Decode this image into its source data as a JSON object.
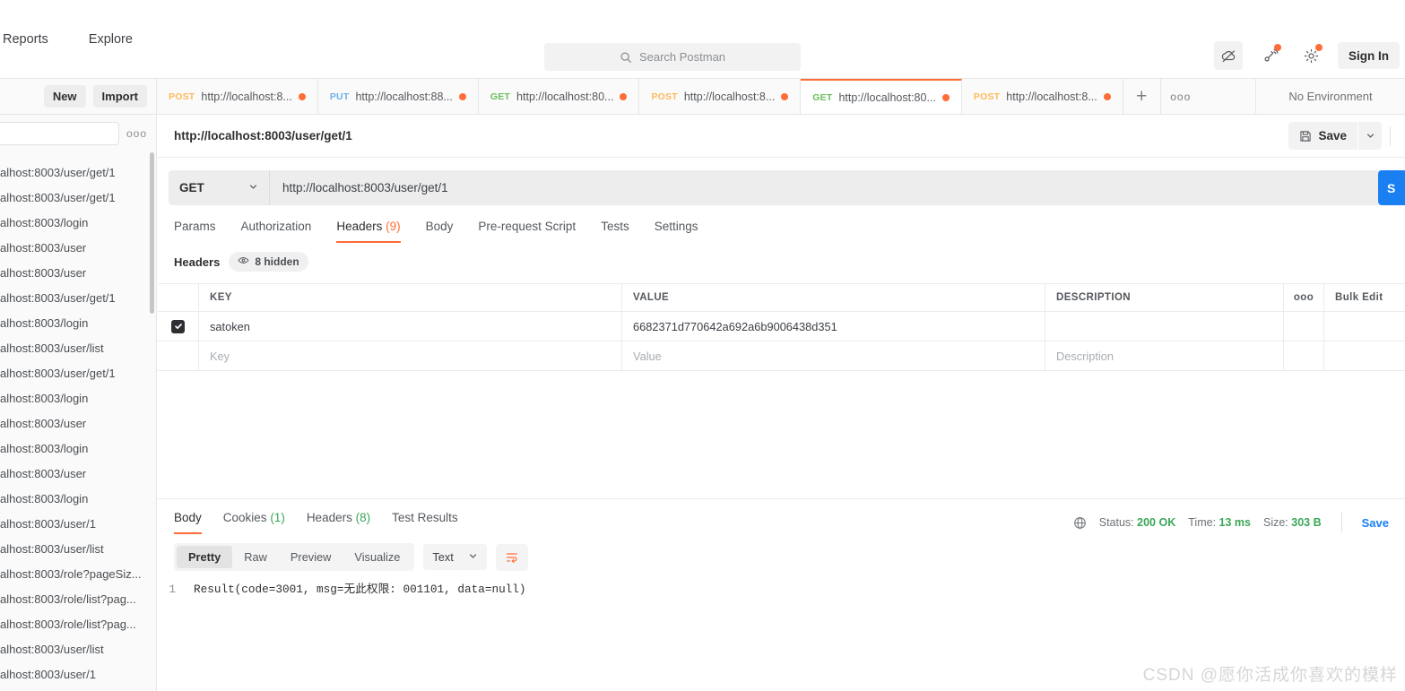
{
  "topnav": {
    "items": [
      {
        "label": "Reports",
        "name": "topnav-reports"
      },
      {
        "label": "Explore",
        "name": "topnav-explore"
      }
    ]
  },
  "search": {
    "placeholder": "Search Postman",
    "icon": "search-icon"
  },
  "account": {
    "signin_label": "Sign In",
    "icons": [
      "cloud-offline-icon",
      "notifications-icon",
      "settings-gear-icon"
    ]
  },
  "toolbar": {
    "new_label": "New",
    "import_label": "Import",
    "environment_label": "No Environment",
    "add_tab_icon": "plus-icon",
    "tab_options_icon": "more-horizontal-icon"
  },
  "request_tabs": [
    {
      "method": "POST",
      "url": "http://localhost:8...",
      "unsaved": true,
      "active": false
    },
    {
      "method": "PUT",
      "url": "http://localhost:88...",
      "unsaved": true,
      "active": false
    },
    {
      "method": "GET",
      "url": "http://localhost:80...",
      "unsaved": true,
      "active": false
    },
    {
      "method": "POST",
      "url": "http://localhost:8...",
      "unsaved": true,
      "active": false
    },
    {
      "method": "GET",
      "url": "http://localhost:80...",
      "unsaved": true,
      "active": true
    },
    {
      "method": "POST",
      "url": "http://localhost:8...",
      "unsaved": true,
      "active": false
    }
  ],
  "sidebar": {
    "search_value": "",
    "more_icon": "more-horizontal-icon",
    "history_items": [
      "alhost:8003/user/get/1",
      "alhost:8003/user/get/1",
      "alhost:8003/login",
      "alhost:8003/user",
      "alhost:8003/user",
      "alhost:8003/user/get/1",
      "alhost:8003/login",
      "alhost:8003/user/list",
      "alhost:8003/user/get/1",
      "alhost:8003/login",
      "alhost:8003/user",
      "alhost:8003/login",
      "alhost:8003/user",
      "alhost:8003/login",
      "alhost:8003/user/1",
      "alhost:8003/user/list",
      "alhost:8003/role?pageSiz...",
      "alhost:8003/role/list?pag...",
      "alhost:8003/role/list?pag...",
      "alhost:8003/user/list",
      "alhost:8003/user/1"
    ]
  },
  "request": {
    "title": "http://localhost:8003/user/get/1",
    "save_label": "Save",
    "save_icon": "floppy-disk-icon",
    "save_caret_icon": "chevron-down-icon",
    "method": "GET",
    "method_caret_icon": "chevron-down-icon",
    "url": "http://localhost:8003/user/get/1",
    "send_label": "S",
    "tabs": [
      {
        "label": "Params",
        "count": "",
        "active": false
      },
      {
        "label": "Authorization",
        "count": "",
        "active": false
      },
      {
        "label": "Headers",
        "count": "(9)",
        "active": true
      },
      {
        "label": "Body",
        "count": "",
        "active": false
      },
      {
        "label": "Pre-request Script",
        "count": "",
        "active": false
      },
      {
        "label": "Tests",
        "count": "",
        "active": false
      },
      {
        "label": "Settings",
        "count": "",
        "active": false
      }
    ],
    "headers_section": {
      "label": "Headers",
      "hidden_label": "8 hidden",
      "hidden_icon": "eye-icon",
      "columns": [
        "KEY",
        "VALUE",
        "DESCRIPTION"
      ],
      "options_icon": "more-horizontal-icon",
      "bulk_edit_label": "Bulk Edit",
      "rows": [
        {
          "checked": true,
          "key": "satoken",
          "value": "6682371d770642a692a6b9006438d351",
          "description": ""
        }
      ],
      "placeholders": {
        "key": "Key",
        "value": "Value",
        "description": "Description"
      }
    }
  },
  "response": {
    "tabs": [
      {
        "label": "Body",
        "count": "",
        "active": true
      },
      {
        "label": "Cookies",
        "count": "(1)",
        "active": false
      },
      {
        "label": "Headers",
        "count": "(8)",
        "active": false
      },
      {
        "label": "Test Results",
        "count": "",
        "active": false
      }
    ],
    "status_icon": "globe-icon",
    "status_label": "Status:",
    "status_value": "200 OK",
    "time_label": "Time:",
    "time_value": "13 ms",
    "size_label": "Size:",
    "size_value": "303 B",
    "save_response_label": "Save",
    "view_modes": [
      {
        "label": "Pretty",
        "active": true
      },
      {
        "label": "Raw",
        "active": false
      },
      {
        "label": "Preview",
        "active": false
      },
      {
        "label": "Visualize",
        "active": false
      }
    ],
    "format": "Text",
    "format_caret_icon": "chevron-down-icon",
    "wrap_icon": "word-wrap-icon",
    "body_lines": [
      {
        "number": "1",
        "text": "Result(code=3001, msg=无此权限: 001101, data=null)"
      }
    ]
  },
  "watermark": {
    "text": "CSDN @愿你活成你喜欢的模样"
  },
  "colors": {
    "accent": "#ff6c37",
    "send": "#1a7ff1",
    "get": "#6bbd5b",
    "post": "#ffb95a",
    "put": "#6eafe8",
    "success": "#3aa757"
  }
}
